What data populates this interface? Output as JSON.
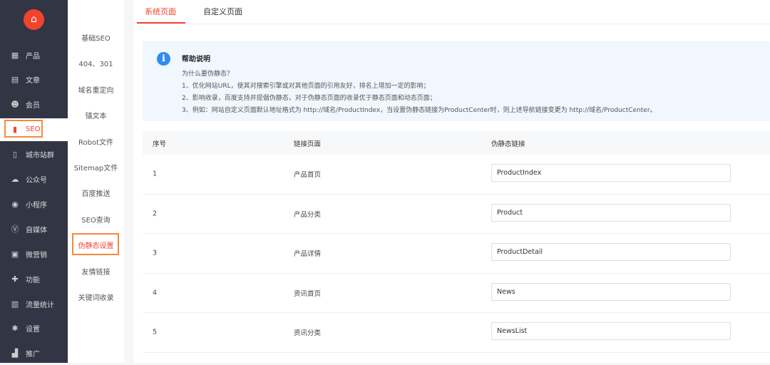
{
  "sidebar": {
    "items": [
      {
        "label": "产品",
        "icon": "grid-icon"
      },
      {
        "label": "文章",
        "icon": "document-icon"
      },
      {
        "label": "会员",
        "icon": "user-icon"
      },
      {
        "label": "SEO",
        "icon": "seo-file-icon"
      },
      {
        "label": "城市站群",
        "icon": "file-icon"
      },
      {
        "label": "公众号",
        "icon": "wechat-icon"
      },
      {
        "label": "小程序",
        "icon": "miniprogram-icon"
      },
      {
        "label": "自媒体",
        "icon": "v-icon"
      },
      {
        "label": "微营销",
        "icon": "gift-icon"
      },
      {
        "label": "功能",
        "icon": "puzzle-icon"
      },
      {
        "label": "流量统计",
        "icon": "bar-chart-icon"
      },
      {
        "label": "设置",
        "icon": "gear-icon"
      },
      {
        "label": "推广",
        "icon": "promote-icon"
      }
    ]
  },
  "submenu": [
    "基础SEO",
    "404、301",
    "域名重定向",
    "锚文本",
    "Robot文件",
    "Sitemap文件",
    "百度推送",
    "SEO查询",
    "伪静态设置",
    "友情链接",
    "关键词收录"
  ],
  "tabs": [
    "系统页面",
    "自定义页面"
  ],
  "help": {
    "title": "帮助说明",
    "lines": [
      "为什么要伪静态？",
      "1、优化网站URL，使其对搜索引擎或对其他页面的引用友好，排名上增加一定的影响；",
      "2、影响收录，百度支持并提倡伪静态，对于伪静态页面的收录优于静态页面和动态页面；",
      "3、例如：网站自定义页面默认地址格式为 http://域名/ProductIndex，当设置伪静态链接为ProductCenter时，则上述导航链接变更为 http://域名/ProductCenter。"
    ]
  },
  "table": {
    "headers": [
      "序号",
      "链接页面",
      "伪静态链接"
    ],
    "rows": [
      [
        "1",
        "产品首页",
        "ProductIndex"
      ],
      [
        "2",
        "产品分类",
        "Product"
      ],
      [
        "3",
        "产品详情",
        "ProductDetail"
      ],
      [
        "4",
        "资讯首页",
        "News"
      ],
      [
        "5",
        "资讯分类",
        "NewsList"
      ]
    ]
  },
  "colors": {
    "accent": "#f2432f",
    "highlight": "#f7893a",
    "sidebar": "#323544"
  }
}
